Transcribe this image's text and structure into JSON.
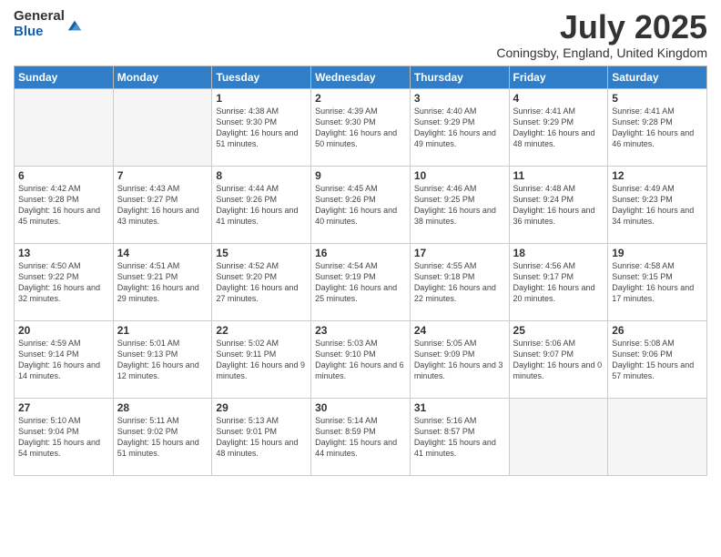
{
  "logo": {
    "general": "General",
    "blue": "Blue"
  },
  "title": "July 2025",
  "subtitle": "Coningsby, England, United Kingdom",
  "days_of_week": [
    "Sunday",
    "Monday",
    "Tuesday",
    "Wednesday",
    "Thursday",
    "Friday",
    "Saturday"
  ],
  "weeks": [
    [
      {
        "day": "",
        "info": ""
      },
      {
        "day": "",
        "info": ""
      },
      {
        "day": "1",
        "info": "Sunrise: 4:38 AM\nSunset: 9:30 PM\nDaylight: 16 hours and 51 minutes."
      },
      {
        "day": "2",
        "info": "Sunrise: 4:39 AM\nSunset: 9:30 PM\nDaylight: 16 hours and 50 minutes."
      },
      {
        "day": "3",
        "info": "Sunrise: 4:40 AM\nSunset: 9:29 PM\nDaylight: 16 hours and 49 minutes."
      },
      {
        "day": "4",
        "info": "Sunrise: 4:41 AM\nSunset: 9:29 PM\nDaylight: 16 hours and 48 minutes."
      },
      {
        "day": "5",
        "info": "Sunrise: 4:41 AM\nSunset: 9:28 PM\nDaylight: 16 hours and 46 minutes."
      }
    ],
    [
      {
        "day": "6",
        "info": "Sunrise: 4:42 AM\nSunset: 9:28 PM\nDaylight: 16 hours and 45 minutes."
      },
      {
        "day": "7",
        "info": "Sunrise: 4:43 AM\nSunset: 9:27 PM\nDaylight: 16 hours and 43 minutes."
      },
      {
        "day": "8",
        "info": "Sunrise: 4:44 AM\nSunset: 9:26 PM\nDaylight: 16 hours and 41 minutes."
      },
      {
        "day": "9",
        "info": "Sunrise: 4:45 AM\nSunset: 9:26 PM\nDaylight: 16 hours and 40 minutes."
      },
      {
        "day": "10",
        "info": "Sunrise: 4:46 AM\nSunset: 9:25 PM\nDaylight: 16 hours and 38 minutes."
      },
      {
        "day": "11",
        "info": "Sunrise: 4:48 AM\nSunset: 9:24 PM\nDaylight: 16 hours and 36 minutes."
      },
      {
        "day": "12",
        "info": "Sunrise: 4:49 AM\nSunset: 9:23 PM\nDaylight: 16 hours and 34 minutes."
      }
    ],
    [
      {
        "day": "13",
        "info": "Sunrise: 4:50 AM\nSunset: 9:22 PM\nDaylight: 16 hours and 32 minutes."
      },
      {
        "day": "14",
        "info": "Sunrise: 4:51 AM\nSunset: 9:21 PM\nDaylight: 16 hours and 29 minutes."
      },
      {
        "day": "15",
        "info": "Sunrise: 4:52 AM\nSunset: 9:20 PM\nDaylight: 16 hours and 27 minutes."
      },
      {
        "day": "16",
        "info": "Sunrise: 4:54 AM\nSunset: 9:19 PM\nDaylight: 16 hours and 25 minutes."
      },
      {
        "day": "17",
        "info": "Sunrise: 4:55 AM\nSunset: 9:18 PM\nDaylight: 16 hours and 22 minutes."
      },
      {
        "day": "18",
        "info": "Sunrise: 4:56 AM\nSunset: 9:17 PM\nDaylight: 16 hours and 20 minutes."
      },
      {
        "day": "19",
        "info": "Sunrise: 4:58 AM\nSunset: 9:15 PM\nDaylight: 16 hours and 17 minutes."
      }
    ],
    [
      {
        "day": "20",
        "info": "Sunrise: 4:59 AM\nSunset: 9:14 PM\nDaylight: 16 hours and 14 minutes."
      },
      {
        "day": "21",
        "info": "Sunrise: 5:01 AM\nSunset: 9:13 PM\nDaylight: 16 hours and 12 minutes."
      },
      {
        "day": "22",
        "info": "Sunrise: 5:02 AM\nSunset: 9:11 PM\nDaylight: 16 hours and 9 minutes."
      },
      {
        "day": "23",
        "info": "Sunrise: 5:03 AM\nSunset: 9:10 PM\nDaylight: 16 hours and 6 minutes."
      },
      {
        "day": "24",
        "info": "Sunrise: 5:05 AM\nSunset: 9:09 PM\nDaylight: 16 hours and 3 minutes."
      },
      {
        "day": "25",
        "info": "Sunrise: 5:06 AM\nSunset: 9:07 PM\nDaylight: 16 hours and 0 minutes."
      },
      {
        "day": "26",
        "info": "Sunrise: 5:08 AM\nSunset: 9:06 PM\nDaylight: 15 hours and 57 minutes."
      }
    ],
    [
      {
        "day": "27",
        "info": "Sunrise: 5:10 AM\nSunset: 9:04 PM\nDaylight: 15 hours and 54 minutes."
      },
      {
        "day": "28",
        "info": "Sunrise: 5:11 AM\nSunset: 9:02 PM\nDaylight: 15 hours and 51 minutes."
      },
      {
        "day": "29",
        "info": "Sunrise: 5:13 AM\nSunset: 9:01 PM\nDaylight: 15 hours and 48 minutes."
      },
      {
        "day": "30",
        "info": "Sunrise: 5:14 AM\nSunset: 8:59 PM\nDaylight: 15 hours and 44 minutes."
      },
      {
        "day": "31",
        "info": "Sunrise: 5:16 AM\nSunset: 8:57 PM\nDaylight: 15 hours and 41 minutes."
      },
      {
        "day": "",
        "info": ""
      },
      {
        "day": "",
        "info": ""
      }
    ]
  ]
}
